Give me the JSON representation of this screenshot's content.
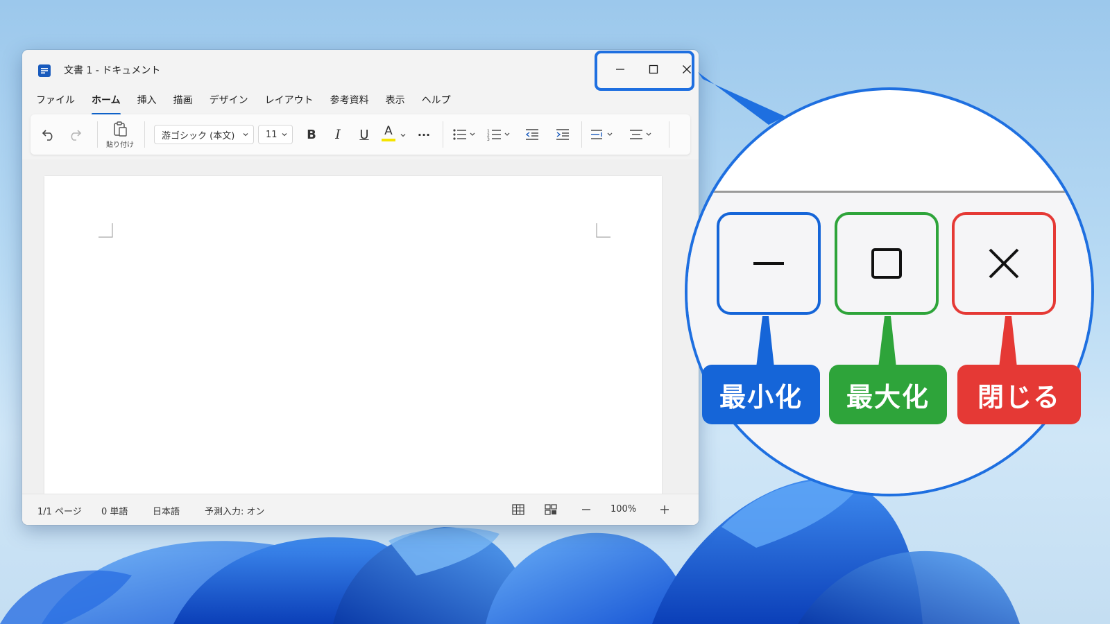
{
  "window": {
    "title": "文書 1 - ドキュメント"
  },
  "menu": {
    "tabs": [
      {
        "label": "ファイル"
      },
      {
        "label": "ホーム"
      },
      {
        "label": "挿入"
      },
      {
        "label": "描画"
      },
      {
        "label": "デザイン"
      },
      {
        "label": "レイアウト"
      },
      {
        "label": "参考資料"
      },
      {
        "label": "表示"
      },
      {
        "label": "ヘルプ"
      }
    ],
    "active_tab": "ホーム"
  },
  "ribbon": {
    "paste_label": "貼り付け",
    "font_name": "游ゴシック (本文)",
    "font_size": "11",
    "bold_glyph": "B",
    "italic_glyph": "I",
    "underline_glyph": "U",
    "font_color_glyph": "A",
    "more_glyph": "···"
  },
  "status": {
    "page": "1/1 ページ",
    "words": "0 単語",
    "language": "日本語",
    "prediction": "予測入力: オン",
    "zoom": "100%"
  },
  "callout": {
    "minimize_label": "最小化",
    "maximize_label": "最大化",
    "close_label": "閉じる"
  },
  "colors": {
    "accent_blue": "#1e6fe0",
    "minimize": "#1565d8",
    "maximize": "#2ea43a",
    "close": "#e53935",
    "active_tab": "#0f62c9",
    "font_color_underline": "#f5e400"
  },
  "icons": {
    "app": "document-app-icon",
    "minimize": "minimize-icon",
    "maximize": "maximize-icon",
    "close": "close-icon",
    "undo": "undo-icon",
    "redo": "redo-icon",
    "paste": "clipboard-icon",
    "bullets": "bullet-list-icon",
    "numbering": "numbered-list-icon",
    "outdent": "decrease-indent-icon",
    "indent": "increase-indent-icon",
    "spacing": "line-spacing-icon",
    "align": "align-center-icon",
    "table_view": "table-icon",
    "focus_view": "view-layout-icon",
    "zoom_out": "zoom-out-icon",
    "zoom_in": "zoom-in-icon"
  }
}
